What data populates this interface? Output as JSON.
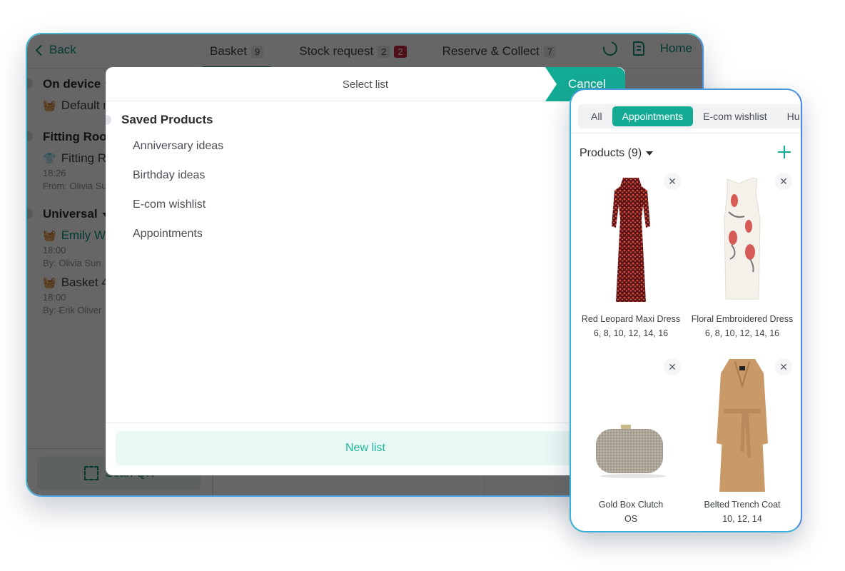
{
  "tablet": {
    "back_label": "Back",
    "tabs": [
      {
        "label": "Basket",
        "count": "9",
        "active": true
      },
      {
        "label": "Stock request",
        "count": "2",
        "alert_count": "2"
      },
      {
        "label": "Reserve & Collect",
        "count": "7"
      }
    ],
    "home_label": "Home",
    "sidebar": {
      "groups": [
        {
          "label": "On device",
          "items": [
            {
              "title": "Default m",
              "icon": "basket-icon"
            }
          ]
        },
        {
          "label": "Fitting Room",
          "items": [
            {
              "title": "Fitting Ro",
              "icon": "hanger-icon",
              "time": "18:26",
              "by": "From: Olivia Su"
            }
          ]
        },
        {
          "label": "Universal",
          "items": [
            {
              "title": "Emily Wh",
              "icon": "basket-icon",
              "time": "18:00",
              "by": "By: Olivia Sun",
              "highlighted": true
            },
            {
              "title": "Basket 4",
              "icon": "basket-icon",
              "time": "18:00",
              "by": "By: Erik Oliver"
            }
          ]
        }
      ]
    },
    "scan_label": "Scan QR"
  },
  "modal": {
    "title": "Select list",
    "cancel_label": "Cancel",
    "group_label": "Saved Products",
    "items": [
      "Anniversary ideas",
      "Birthday ideas",
      "E-com wishlist",
      "Appointments"
    ],
    "new_list_label": "New list"
  },
  "phone": {
    "tabs": [
      {
        "label": "All"
      },
      {
        "label": "Appointments",
        "active": true
      },
      {
        "label": "E-com wishlist"
      },
      {
        "label": "Hu"
      }
    ],
    "products_label": "Products (9)",
    "products": [
      {
        "name": "Red Leopard Maxi Dress",
        "sizes": "6, 8, 10, 12, 14, 16"
      },
      {
        "name": "Floral Embroidered Dress",
        "sizes": "6, 8, 10, 12, 14, 16"
      },
      {
        "name": "Gold Box Clutch",
        "sizes": "OS"
      },
      {
        "name": "Belted Trench Coat",
        "sizes": "10, 12, 14"
      }
    ]
  },
  "colors": {
    "accent": "#14ab94",
    "accent_dark": "#0d8f7a",
    "alert": "#c8283a",
    "frame": "#3fb8d0"
  }
}
